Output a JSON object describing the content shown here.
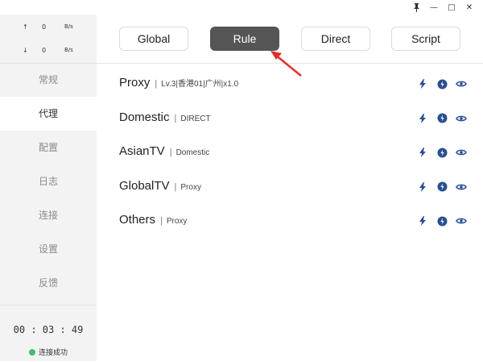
{
  "window": {
    "pin_glyph": "⩛",
    "minimize_glyph": "—",
    "maximize_glyph": "□",
    "close_glyph": "✕"
  },
  "traffic": {
    "up": {
      "arrow": "↑",
      "value": "0",
      "unit": "B/s"
    },
    "down": {
      "arrow": "↓",
      "value": "0",
      "unit": "B/s"
    }
  },
  "sidebar": {
    "items": [
      {
        "label": "常规"
      },
      {
        "label": "代理"
      },
      {
        "label": "配置"
      },
      {
        "label": "日志"
      },
      {
        "label": "连接"
      },
      {
        "label": "设置"
      },
      {
        "label": "反馈"
      }
    ],
    "active_index": 1
  },
  "footer": {
    "uptime": "00 : 03 : 49",
    "status": "连接成功"
  },
  "modes": [
    {
      "label": "Global"
    },
    {
      "label": "Rule"
    },
    {
      "label": "Direct"
    },
    {
      "label": "Script"
    }
  ],
  "active_mode_index": 1,
  "proxy_groups": [
    {
      "name": "Proxy",
      "selected": "Lv.3|香港01|广州|x1.0"
    },
    {
      "name": "Domestic",
      "selected": "DIRECT"
    },
    {
      "name": "AsianTV",
      "selected": "Domestic"
    },
    {
      "name": "GlobalTV",
      "selected": "Proxy"
    },
    {
      "name": "Others",
      "selected": "Proxy"
    }
  ],
  "separator": "|",
  "colors": {
    "accent": "#2a4f8f",
    "active_mode_bg": "#555555",
    "status_ok": "#3cbf6e",
    "pointer": "#e0302a"
  },
  "icons": [
    "bolt-icon",
    "speed-test-icon",
    "eye-icon"
  ]
}
